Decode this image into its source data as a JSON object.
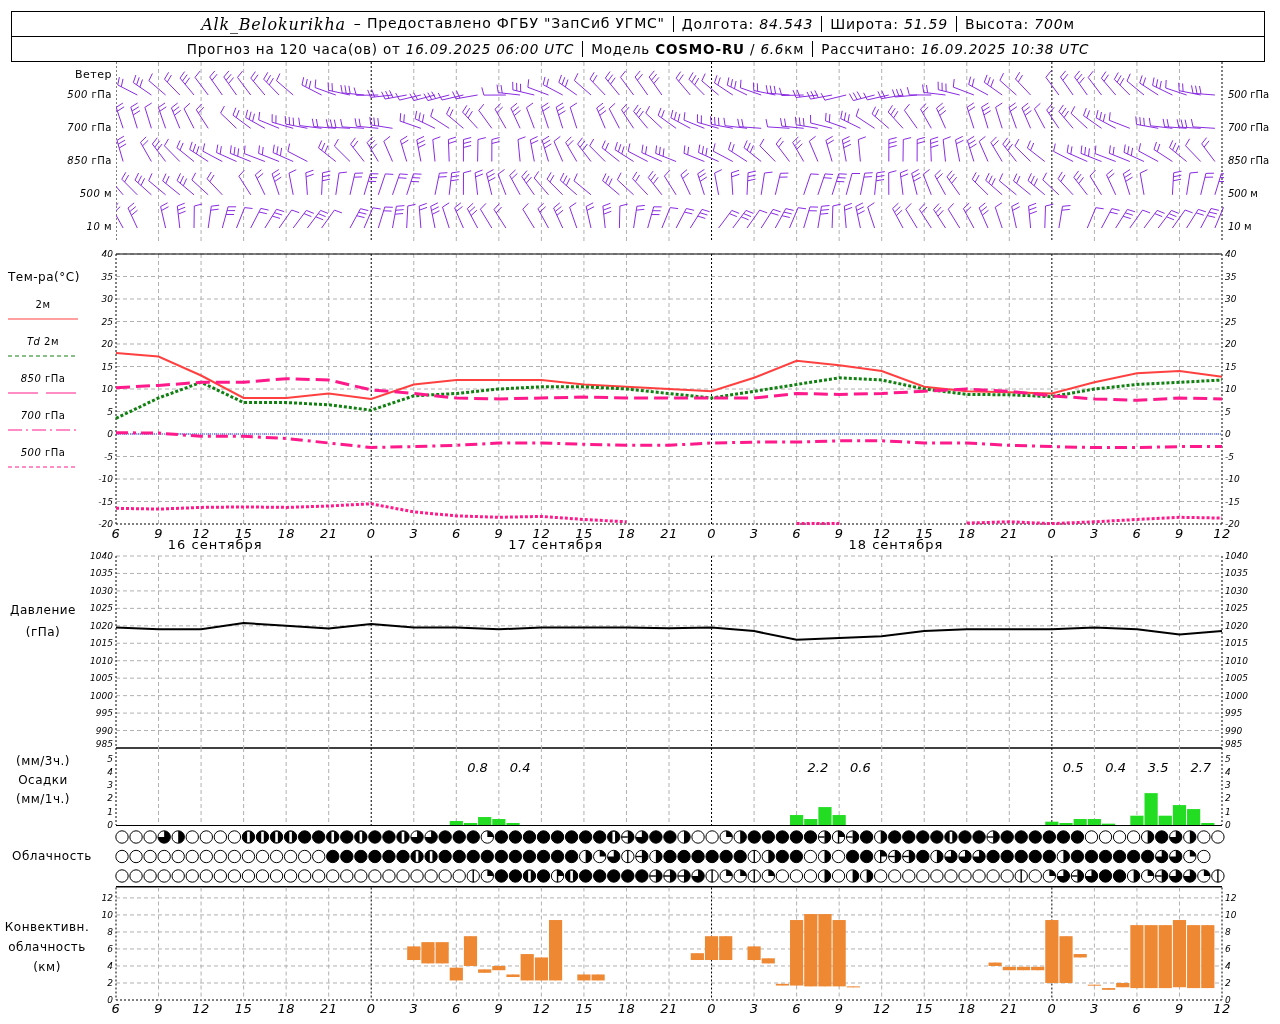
{
  "header": {
    "station": "Alk_Belokurikha",
    "provider": "– Предоставлено ФГБУ \"ЗапСиб УГМС\"",
    "row1": [
      {
        "text": "Долгота: *84.543*"
      },
      {
        "text": "Широта: *51.59*"
      },
      {
        "text": "Высота: *700*",
        "unit": "м"
      }
    ],
    "row2": [
      {
        "text": "Прогноз на 120 часа(ов) от *16.09.2025 06:00 UTC*"
      },
      {
        "text": "Модель **COSMO-RU** / *6.6*",
        "unit": "км"
      },
      {
        "text": "Рассчитано: *16.09.2025 10:38 UTC*"
      }
    ]
  },
  "wind": {
    "title": "Ветер",
    "levels": [
      {
        "left": "*500* гПа",
        "right": "*500* гПа"
      },
      {
        "left": "*700* гПа",
        "right": "*700* гПа"
      },
      {
        "left": "*850* гПа",
        "right": "*850* гПа"
      },
      {
        "left": "*500* м",
        "right": "*500* м"
      },
      {
        "left": "*10* м",
        "right": "*10* м"
      }
    ]
  },
  "temperature": {
    "title": "Тем-ра(°С)",
    "dates": [
      "16 сентября",
      "17 сентября",
      "18 сентября"
    ],
    "right_ticks": [
      "40",
      "35",
      "30",
      "25",
      "20",
      "15",
      "10",
      "5",
      "0",
      "-5",
      "-10",
      "-15",
      "-20"
    ],
    "chart_data": {
      "type": "line",
      "grid": true,
      "ylim": [
        -20,
        40
      ],
      "ref_lines": [
        {
          "axis": "y",
          "value": 0,
          "color": "#2040ff",
          "line_style": "dotted"
        }
      ],
      "yticks": [
        -20,
        -15,
        -10,
        -5,
        0,
        5,
        10,
        15,
        20,
        25,
        30,
        35,
        40
      ],
      "categories": [
        "6",
        "9",
        "12",
        "15",
        "18",
        "21",
        "0",
        "3",
        "6",
        "9",
        "12",
        "15",
        "18",
        "21",
        "0",
        "3",
        "6",
        "9",
        "12",
        "15",
        "18",
        "21",
        "0",
        "3",
        "6",
        "9",
        "12"
      ],
      "series": [
        {
          "name": "2м",
          "line_style": "solid",
          "color": "#ff4040",
          "values": [
            18,
            17.2,
            13,
            8,
            8,
            9,
            7.8,
            11,
            12,
            12,
            12,
            11,
            10.5,
            10,
            9.5,
            12.5,
            16.3,
            15.3,
            14,
            10.5,
            9.5,
            9.3,
            9,
            11.5,
            13.5,
            14,
            12.7
          ]
        },
        {
          "name": "*Td* 2м",
          "line_style": "dotted",
          "color": "#108010",
          "values": [
            3.5,
            8,
            11.5,
            7,
            7,
            6.5,
            5.3,
            8.5,
            9,
            10,
            10.5,
            10.5,
            10,
            9,
            8,
            9.5,
            11,
            12.5,
            12,
            10,
            8.8,
            8.7,
            8.3,
            10,
            11,
            11.5,
            12
          ]
        },
        {
          "name": "*850* гПа",
          "line_style": "dashed",
          "color": "#ff1a8c",
          "values": [
            10.3,
            10.8,
            11.5,
            11.5,
            12.3,
            12,
            9.8,
            9,
            8,
            7.8,
            8,
            8.2,
            8,
            8,
            8,
            8,
            9,
            8.8,
            9,
            9.5,
            10,
            9.5,
            8.5,
            7.8,
            7.5,
            8,
            7.8
          ]
        },
        {
          "name": "*700* гПа",
          "line_style": "dashdot",
          "color": "#ff1a8c",
          "values": [
            0.3,
            0.2,
            -0.5,
            -0.5,
            -1,
            -2,
            -3,
            -2.8,
            -2.5,
            -2,
            -2,
            -2.3,
            -2.5,
            -2.5,
            -2,
            -1.8,
            -1.8,
            -1.5,
            -1.5,
            -2,
            -2,
            -2.5,
            -2.8,
            -3,
            -3,
            -2.8,
            -2.8
          ]
        },
        {
          "name": "*500* гПа",
          "line_style": "dotted",
          "color": "#ff1a8c",
          "values": [
            -16.5,
            -16.7,
            -16.3,
            -16.2,
            -16.3,
            -16,
            -15.5,
            -17.3,
            -18.2,
            -18.5,
            -18.3,
            -19,
            -19.5,
            null,
            null,
            null,
            -19.9,
            -19.9,
            null,
            null,
            -19.8,
            -19.5,
            -19.9,
            -19.5,
            -19,
            -18.5,
            -18.7
          ]
        }
      ]
    }
  },
  "pressure": {
    "title": "Давление",
    "unit": "(гПа)",
    "right_ticks": [
      "1040",
      "1035",
      "1030",
      "1025",
      "1020",
      "1015",
      "1010",
      "1005",
      "1000",
      "995",
      "990",
      "985"
    ],
    "chart_data": {
      "type": "line",
      "grid": true,
      "ylim": [
        985,
        1040
      ],
      "yticks": [
        985,
        990,
        995,
        1000,
        1005,
        1010,
        1015,
        1020,
        1025,
        1030,
        1035,
        1040
      ],
      "categories": [
        null,
        null,
        null,
        null,
        null,
        null,
        null,
        null,
        null,
        null,
        null,
        null,
        null,
        null,
        null,
        null,
        null,
        null,
        null,
        null,
        null,
        null,
        null,
        null,
        null,
        null,
        null
      ],
      "series": [
        {
          "color": "#000000",
          "values": [
            1019.5,
            1019,
            1019,
            1020.8,
            1020,
            1019.2,
            1020.5,
            1019.5,
            1019.5,
            1019,
            1019.5,
            1019.5,
            1019.5,
            1019.3,
            1019.5,
            1018.5,
            1016,
            1016.5,
            1017,
            1018.5,
            1019,
            1019,
            1019,
            1019.5,
            1019,
            1017.5,
            1018.5
          ]
        }
      ]
    }
  },
  "precipitation": {
    "labels": [
      "(мм/3ч.)",
      "Осадки",
      "(мм/1ч.)"
    ],
    "totals": [
      "0.8",
      "0.4",
      "2.2",
      "0.6",
      "0.5",
      "0.4",
      "3.5",
      "2.7"
    ],
    "right_ticks": [
      "5",
      "4",
      "3",
      "2",
      "1",
      "0"
    ],
    "chart_data": {
      "type": "bar",
      "grid": true,
      "ylim": [
        0,
        5.8
      ],
      "yticks": [
        0,
        1,
        2,
        3,
        4,
        5
      ],
      "categories": [
        null,
        null,
        null,
        null,
        null,
        null,
        null,
        null,
        null,
        null,
        null,
        null,
        null,
        null,
        null,
        null,
        null,
        null,
        null,
        null,
        null,
        null,
        null,
        null,
        null,
        null,
        null,
        null,
        null,
        null,
        null,
        null,
        null,
        null,
        null,
        null,
        null,
        null,
        null,
        null,
        null,
        null,
        null,
        null,
        null,
        null,
        null,
        null,
        null,
        null,
        null,
        null,
        null,
        null,
        null,
        null,
        null,
        null,
        null,
        null,
        null,
        null,
        null,
        null,
        null,
        null,
        null,
        null,
        null,
        null,
        null,
        null,
        null,
        null,
        null,
        null,
        null,
        null,
        null
      ],
      "series": [
        {
          "color": "#22dd22",
          "values": [
            null,
            null,
            null,
            null,
            null,
            null,
            null,
            null,
            null,
            null,
            null,
            null,
            null,
            null,
            null,
            null,
            null,
            null,
            null,
            null,
            null,
            null,
            null,
            null,
            0.3,
            0.15,
            0.6,
            0.45,
            0.15,
            null,
            null,
            null,
            null,
            null,
            null,
            null,
            null,
            null,
            null,
            null,
            null,
            null,
            null,
            null,
            null,
            null,
            null,
            null,
            0.75,
            0.45,
            1.35,
            0.75,
            null,
            null,
            null,
            null,
            null,
            null,
            null,
            null,
            null,
            null,
            null,
            null,
            null,
            null,
            0.25,
            0.15,
            0.45,
            0.45,
            0.1,
            null,
            0.7,
            2.4,
            0.7,
            1.5,
            1.2,
            0.15,
            null
          ]
        }
      ]
    }
  },
  "cloudiness": {
    "title": "Облачность",
    "rows": [
      [
        {
          "kind": "clear"
        },
        {
          "kind": "clear"
        },
        {
          "kind": "clear"
        },
        {
          "kind": "six"
        },
        {
          "kind": "half"
        },
        {
          "kind": "clear"
        },
        {
          "kind": "clear"
        },
        {
          "kind": "clear"
        },
        {
          "kind": "clear"
        },
        {
          "kind": "seven"
        },
        {
          "kind": "seven"
        },
        {
          "kind": "seven"
        },
        {
          "kind": "seven"
        },
        {
          "kind": "overcast"
        },
        {
          "kind": "overcast"
        },
        {
          "kind": "seven"
        },
        {
          "kind": "overcast"
        },
        {
          "kind": "seven"
        },
        {
          "kind": "overcast"
        },
        {
          "kind": "overcast"
        },
        {
          "kind": "seven"
        },
        {
          "kind": "six"
        },
        {
          "kind": "six"
        },
        {
          "kind": "overcast"
        },
        {
          "kind": "overcast"
        },
        {
          "kind": "overcast"
        },
        {
          "kind": "two"
        },
        {
          "kind": "overcast"
        },
        {
          "kind": "overcast"
        },
        {
          "kind": "overcast"
        },
        {
          "kind": "overcast"
        },
        {
          "kind": "overcast"
        },
        {
          "kind": "overcast"
        },
        {
          "kind": "overcast"
        },
        {
          "kind": "overcast"
        },
        {
          "kind": "seven"
        },
        {
          "kind": "five"
        },
        {
          "kind": "six"
        },
        {
          "kind": "overcast"
        },
        {
          "kind": "overcast"
        },
        {
          "kind": "half"
        },
        {
          "kind": "clear"
        },
        {
          "kind": "clear"
        },
        {
          "kind": "two"
        },
        {
          "kind": "half"
        },
        {
          "kind": "overcast"
        },
        {
          "kind": "overcast"
        },
        {
          "kind": "overcast"
        },
        {
          "kind": "overcast"
        },
        {
          "kind": "overcast"
        },
        {
          "kind": "five"
        },
        {
          "kind": "three"
        },
        {
          "kind": "five"
        },
        {
          "kind": "overcast"
        },
        {
          "kind": "half"
        },
        {
          "kind": "overcast"
        },
        {
          "kind": "overcast"
        },
        {
          "kind": "overcast"
        },
        {
          "kind": "overcast"
        },
        {
          "kind": "seven"
        },
        {
          "kind": "overcast"
        },
        {
          "kind": "overcast"
        },
        {
          "kind": "five"
        },
        {
          "kind": "overcast"
        },
        {
          "kind": "overcast"
        },
        {
          "kind": "overcast"
        },
        {
          "kind": "overcast"
        },
        {
          "kind": "overcast"
        },
        {
          "kind": "overcast"
        },
        {
          "kind": "clear"
        },
        {
          "kind": "clear"
        },
        {
          "kind": "clear"
        },
        {
          "kind": "clear"
        },
        {
          "kind": "half"
        },
        {
          "kind": "overcast"
        },
        {
          "kind": "six"
        },
        {
          "kind": "half"
        },
        {
          "kind": "clear"
        },
        {
          "kind": "clear"
        }
      ],
      [
        {
          "kind": "clear"
        },
        {
          "kind": "clear"
        },
        {
          "kind": "clear"
        },
        {
          "kind": "clear"
        },
        {
          "kind": "clear"
        },
        {
          "kind": "clear"
        },
        {
          "kind": "clear"
        },
        {
          "kind": "clear"
        },
        {
          "kind": "clear"
        },
        {
          "kind": "clear"
        },
        {
          "kind": "clear"
        },
        {
          "kind": "clear"
        },
        {
          "kind": "clear"
        },
        {
          "kind": "clear"
        },
        {
          "kind": "clear"
        },
        {
          "kind": "overcast"
        },
        {
          "kind": "overcast"
        },
        {
          "kind": "overcast"
        },
        {
          "kind": "overcast"
        },
        {
          "kind": "overcast"
        },
        {
          "kind": "overcast"
        },
        {
          "kind": "seven"
        },
        {
          "kind": "seven"
        },
        {
          "kind": "overcast"
        },
        {
          "kind": "overcast"
        },
        {
          "kind": "overcast"
        },
        {
          "kind": "overcast"
        },
        {
          "kind": "overcast"
        },
        {
          "kind": "overcast"
        },
        {
          "kind": "overcast"
        },
        {
          "kind": "overcast"
        },
        {
          "kind": "overcast"
        },
        {
          "kind": "overcast"
        },
        {
          "kind": "half"
        },
        {
          "kind": "two"
        },
        {
          "kind": "six"
        },
        {
          "kind": "one"
        },
        {
          "kind": "five"
        },
        {
          "kind": "half"
        },
        {
          "kind": "overcast"
        },
        {
          "kind": "overcast"
        },
        {
          "kind": "overcast"
        },
        {
          "kind": "overcast"
        },
        {
          "kind": "overcast"
        },
        {
          "kind": "overcast"
        },
        {
          "kind": "one"
        },
        {
          "kind": "half"
        },
        {
          "kind": "overcast"
        },
        {
          "kind": "overcast"
        },
        {
          "kind": "clear"
        },
        {
          "kind": "half"
        },
        {
          "kind": "clear"
        },
        {
          "kind": "overcast"
        },
        {
          "kind": "overcast"
        },
        {
          "kind": "three"
        },
        {
          "kind": "five"
        },
        {
          "kind": "five"
        },
        {
          "kind": "overcast"
        },
        {
          "kind": "half"
        },
        {
          "kind": "six"
        },
        {
          "kind": "six"
        },
        {
          "kind": "six"
        },
        {
          "kind": "overcast"
        },
        {
          "kind": "overcast"
        },
        {
          "kind": "overcast"
        },
        {
          "kind": "overcast"
        },
        {
          "kind": "overcast"
        },
        {
          "kind": "half"
        },
        {
          "kind": "overcast"
        },
        {
          "kind": "overcast"
        },
        {
          "kind": "overcast"
        },
        {
          "kind": "overcast"
        },
        {
          "kind": "overcast"
        },
        {
          "kind": "overcast"
        },
        {
          "kind": "six"
        },
        {
          "kind": "six"
        },
        {
          "kind": "two"
        },
        {
          "kind": "clear"
        }
      ],
      [
        {
          "kind": "clear"
        },
        {
          "kind": "clear"
        },
        {
          "kind": "clear"
        },
        {
          "kind": "clear"
        },
        {
          "kind": "clear"
        },
        {
          "kind": "clear"
        },
        {
          "kind": "clear"
        },
        {
          "kind": "clear"
        },
        {
          "kind": "clear"
        },
        {
          "kind": "clear"
        },
        {
          "kind": "clear"
        },
        {
          "kind": "clear"
        },
        {
          "kind": "clear"
        },
        {
          "kind": "clear"
        },
        {
          "kind": "clear"
        },
        {
          "kind": "clear"
        },
        {
          "kind": "clear"
        },
        {
          "kind": "clear"
        },
        {
          "kind": "clear"
        },
        {
          "kind": "clear"
        },
        {
          "kind": "clear"
        },
        {
          "kind": "clear"
        },
        {
          "kind": "clear"
        },
        {
          "kind": "clear"
        },
        {
          "kind": "clear"
        },
        {
          "kind": "one"
        },
        {
          "kind": "two"
        },
        {
          "kind": "overcast"
        },
        {
          "kind": "overcast"
        },
        {
          "kind": "seven"
        },
        {
          "kind": "overcast"
        },
        {
          "kind": "three"
        },
        {
          "kind": "seven"
        },
        {
          "kind": "overcast"
        },
        {
          "kind": "overcast"
        },
        {
          "kind": "overcast"
        },
        {
          "kind": "overcast"
        },
        {
          "kind": "overcast"
        },
        {
          "kind": "five"
        },
        {
          "kind": "five"
        },
        {
          "kind": "five"
        },
        {
          "kind": "six"
        },
        {
          "kind": "one"
        },
        {
          "kind": "two"
        },
        {
          "kind": "two"
        },
        {
          "kind": "one"
        },
        {
          "kind": "two"
        },
        {
          "kind": "clear"
        },
        {
          "kind": "clear"
        },
        {
          "kind": "clear"
        },
        {
          "kind": "half"
        },
        {
          "kind": "clear"
        },
        {
          "kind": "half"
        },
        {
          "kind": "half"
        },
        {
          "kind": "clear"
        },
        {
          "kind": "clear"
        },
        {
          "kind": "clear"
        },
        {
          "kind": "clear"
        },
        {
          "kind": "clear"
        },
        {
          "kind": "clear"
        },
        {
          "kind": "clear"
        },
        {
          "kind": "clear"
        },
        {
          "kind": "clear"
        },
        {
          "kind": "clear"
        },
        {
          "kind": "one"
        },
        {
          "kind": "clear"
        },
        {
          "kind": "two"
        },
        {
          "kind": "six"
        },
        {
          "kind": "five"
        },
        {
          "kind": "six"
        },
        {
          "kind": "overcast"
        },
        {
          "kind": "overcast"
        },
        {
          "kind": "half"
        },
        {
          "kind": "two"
        },
        {
          "kind": "five"
        },
        {
          "kind": "six"
        },
        {
          "kind": "six"
        },
        {
          "kind": "two"
        },
        {
          "kind": "one"
        }
      ]
    ]
  },
  "convective": {
    "labels": [
      "Конвективн.",
      "облачность",
      "(км)"
    ],
    "right_ticks": [
      "12",
      "10",
      "8",
      "6",
      "4",
      "2",
      "0"
    ],
    "chart_data": {
      "type": "candlestick",
      "grid": true,
      "ylim": [
        0,
        13.4
      ],
      "yticks": [
        0,
        2,
        4,
        6,
        8,
        10,
        12
      ],
      "categories": [
        "6",
        null,
        null,
        "9",
        null,
        null,
        "12",
        null,
        null,
        "15",
        null,
        null,
        "18",
        null,
        null,
        "21",
        null,
        null,
        "0",
        null,
        null,
        "3",
        null,
        null,
        "6",
        null,
        null,
        "9",
        null,
        null,
        "12",
        null,
        null,
        "15",
        null,
        null,
        "18",
        null,
        null,
        "21",
        null,
        null,
        "0",
        null,
        null,
        "3",
        null,
        null,
        "6",
        null,
        null,
        "9",
        null,
        null,
        "12",
        null,
        null,
        "15",
        null,
        null,
        "18",
        null,
        null,
        "21",
        null,
        null,
        "0",
        null,
        null,
        "3",
        null,
        null,
        "6",
        null,
        null,
        "9",
        null,
        null,
        "12"
      ],
      "ohlc": [
        null,
        null,
        null,
        null,
        null,
        null,
        null,
        null,
        null,
        null,
        null,
        null,
        null,
        null,
        null,
        null,
        null,
        null,
        null,
        null,
        null,
        [
          4.7,
          6.3,
          4.7,
          6.3
        ],
        [
          4.3,
          6.8,
          4.3,
          6.8
        ],
        [
          4.3,
          6.8,
          4.3,
          6.8
        ],
        [
          2.3,
          3.8,
          2.3,
          3.8
        ],
        [
          4,
          7.5,
          4,
          7.5
        ],
        [
          3.2,
          3.6,
          3.2,
          3.6
        ],
        [
          3.5,
          4,
          3.5,
          4
        ],
        [
          2.7,
          3,
          2.7,
          3
        ],
        [
          2.3,
          5.4,
          2.3,
          5.4
        ],
        [
          2.3,
          5,
          2.3,
          5
        ],
        [
          2.3,
          9.4,
          2.3,
          9.4
        ],
        null,
        [
          2.3,
          3,
          2.3,
          3
        ],
        [
          2.3,
          3,
          2.3,
          3
        ],
        null,
        null,
        null,
        null,
        null,
        null,
        [
          4.7,
          5.5,
          4.7,
          5.5
        ],
        [
          4.7,
          7.5,
          4.7,
          7.5
        ],
        [
          4.7,
          7.5,
          4.7,
          7.5
        ],
        null,
        [
          4.7,
          6.3,
          4.7,
          6.3
        ],
        [
          4.3,
          4.9,
          4.3,
          4.9
        ],
        [
          1.7,
          1.9,
          1.7,
          1.9
        ],
        [
          1.7,
          9.4,
          1.7,
          9.4
        ],
        [
          1.6,
          10.1,
          1.6,
          10.1
        ],
        [
          1.6,
          10.1,
          1.6,
          10.1
        ],
        [
          1.6,
          9.4,
          1.6,
          9.4
        ],
        [
          1.5,
          1.6,
          1.5,
          1.6
        ],
        null,
        null,
        null,
        null,
        null,
        null,
        null,
        null,
        null,
        [
          4,
          4.4,
          4,
          4.4
        ],
        [
          3.5,
          3.9,
          3.5,
          3.9
        ],
        [
          3.5,
          3.9,
          3.5,
          3.9
        ],
        [
          3.5,
          3.9,
          3.5,
          3.9
        ],
        [
          2,
          9.4,
          2,
          9.4
        ],
        [
          2,
          7.5,
          2,
          7.5
        ],
        [
          5,
          5.4,
          5,
          5.4
        ],
        [
          1.7,
          1.8,
          1.7,
          1.8
        ],
        [
          1.2,
          1.4,
          1.2,
          1.4
        ],
        [
          1.5,
          2,
          1.5,
          2
        ],
        [
          1.4,
          8.8,
          1.4,
          8.8
        ],
        [
          1.4,
          8.8,
          1.4,
          8.8
        ],
        [
          1.4,
          8.8,
          1.4,
          8.8
        ],
        [
          1.5,
          9.4,
          1.5,
          9.4
        ],
        [
          1.4,
          8.8,
          1.4,
          8.8
        ],
        [
          1.4,
          8.8,
          1.4,
          8.8
        ],
        null
      ]
    }
  }
}
